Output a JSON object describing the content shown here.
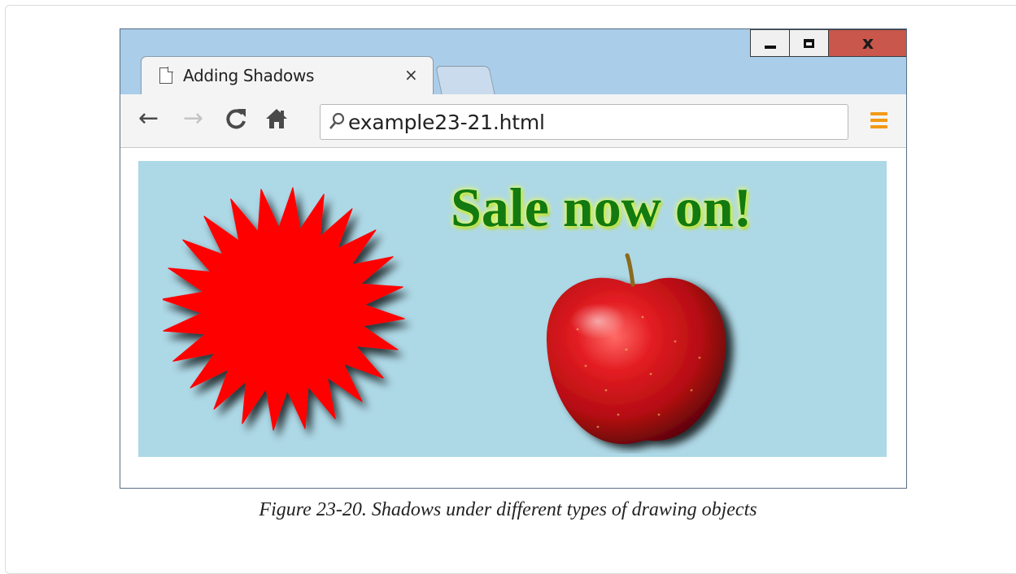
{
  "browser": {
    "tab_title": "Adding Shadows",
    "tab_close_glyph": "×",
    "address": "example23-21.html",
    "window_close_label": "x",
    "icons": {
      "back": "back-arrow-icon",
      "forward": "forward-arrow-icon",
      "reload": "reload-icon",
      "home": "home-icon",
      "search": "search-icon",
      "menu": "menu-icon"
    }
  },
  "canvas": {
    "headline": "Sale now on!",
    "background": "#add8e6",
    "headline_color": "#127a10",
    "burst_color": "#ff0000"
  },
  "caption": "Figure 23-20. Shadows under different types of drawing objects"
}
